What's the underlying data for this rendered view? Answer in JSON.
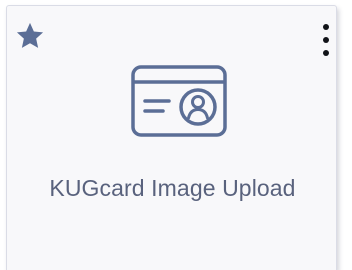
{
  "tile": {
    "title": "KUGcard Image Upload",
    "star_icon": "star-icon",
    "more_icon": "more-vertical-icon",
    "card_icon": "id-card-icon",
    "colors": {
      "icon": "#5b6e96",
      "title": "#59627d",
      "kebab": "#111318",
      "background": "#f8f8fa"
    }
  }
}
